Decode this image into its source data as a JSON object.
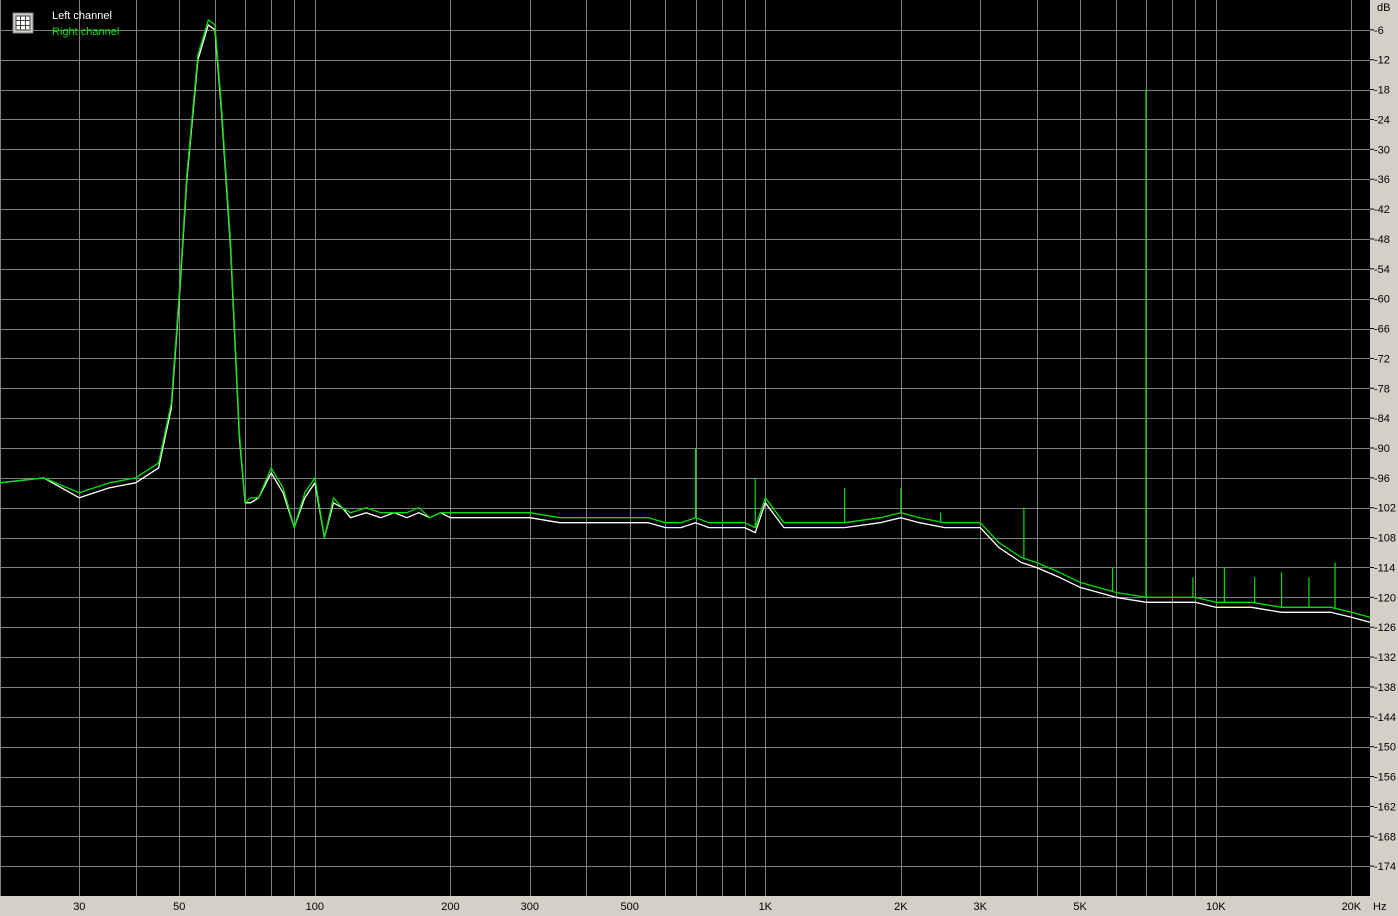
{
  "chart_data": {
    "type": "line",
    "x_scale": "log",
    "xlim": [
      20,
      22000
    ],
    "ylim": [
      -180,
      0
    ],
    "grid": true,
    "legend_position": "top-left",
    "y_unit": "dB",
    "x_unit": "Hz",
    "y_ticks": [
      "-6",
      "-12",
      "-18",
      "-24",
      "-30",
      "-36",
      "-42",
      "-48",
      "-54",
      "-60",
      "-66",
      "-72",
      "-78",
      "-84",
      "-90",
      "-96",
      "-102",
      "-108",
      "-114",
      "-120",
      "-126",
      "-132",
      "-138",
      "-144",
      "-150",
      "-156",
      "-162",
      "-168",
      "-174"
    ],
    "x_ticks": [
      {
        "value": 30,
        "label": "30"
      },
      {
        "value": 50,
        "label": "50"
      },
      {
        "value": 100,
        "label": "100"
      },
      {
        "value": 200,
        "label": "200"
      },
      {
        "value": 300,
        "label": "300"
      },
      {
        "value": 500,
        "label": "500"
      },
      {
        "value": 1000,
        "label": "1K"
      },
      {
        "value": 2000,
        "label": "2K"
      },
      {
        "value": 3000,
        "label": "3K"
      },
      {
        "value": 5000,
        "label": "5K"
      },
      {
        "value": 10000,
        "label": "10K"
      },
      {
        "value": 20000,
        "label": "20K"
      }
    ],
    "series": [
      {
        "name": "Left channel",
        "color": "#ffffff",
        "x": [
          20,
          25,
          30,
          35,
          40,
          45,
          48,
          50,
          52,
          55,
          58,
          60,
          62,
          65,
          68,
          70,
          72,
          75,
          80,
          85,
          90,
          95,
          100,
          105,
          110,
          115,
          120,
          130,
          140,
          150,
          160,
          170,
          180,
          190,
          200,
          220,
          250,
          300,
          350,
          400,
          450,
          500,
          550,
          600,
          650,
          700,
          750,
          800,
          850,
          900,
          950,
          1000,
          1100,
          1200,
          1300,
          1500,
          1800,
          2000,
          2200,
          2500,
          2800,
          3000,
          3300,
          3700,
          4000,
          4500,
          5000,
          6000,
          7000,
          8000,
          9000,
          10000,
          12000,
          14000,
          16000,
          18000,
          20000,
          22000
        ],
        "y": [
          -97,
          -96,
          -100,
          -98,
          -97,
          -94,
          -82,
          -60,
          -36,
          -12,
          -5,
          -6,
          -22,
          -50,
          -88,
          -101,
          -101,
          -100,
          -95,
          -99,
          -106,
          -100,
          -97,
          -108,
          -101,
          -102,
          -104,
          -103,
          -104,
          -103,
          -104,
          -103,
          -104,
          -103,
          -104,
          -104,
          -104,
          -104,
          -105,
          -105,
          -105,
          -105,
          -105,
          -106,
          -106,
          -105,
          -106,
          -106,
          -106,
          -106,
          -107,
          -101,
          -106,
          -106,
          -106,
          -106,
          -105,
          -104,
          -105,
          -106,
          -106,
          -106,
          -110,
          -113,
          -114,
          -116,
          -118,
          -120,
          -121,
          -121,
          -121,
          -122,
          -122,
          -123,
          -123,
          -123,
          -124,
          -125
        ]
      },
      {
        "name": "Right channel",
        "color": "#00e000",
        "x": [
          20,
          25,
          30,
          35,
          40,
          45,
          48,
          50,
          52,
          55,
          58,
          60,
          62,
          65,
          68,
          70,
          72,
          75,
          80,
          85,
          90,
          95,
          100,
          105,
          110,
          115,
          120,
          130,
          140,
          150,
          160,
          170,
          180,
          190,
          200,
          220,
          250,
          300,
          350,
          400,
          450,
          500,
          550,
          600,
          650,
          700,
          750,
          800,
          850,
          900,
          950,
          1000,
          1100,
          1200,
          1300,
          1500,
          1800,
          2000,
          2200,
          2500,
          2800,
          3000,
          3300,
          3700,
          4000,
          4500,
          5000,
          6000,
          7000,
          8000,
          9000,
          10000,
          12000,
          14000,
          16000,
          18000,
          20000,
          22000
        ],
        "y": [
          -97,
          -96,
          -99,
          -97,
          -96,
          -93,
          -81,
          -59,
          -35,
          -11,
          -4,
          -5,
          -21,
          -49,
          -87,
          -101,
          -100,
          -100,
          -94,
          -98,
          -106,
          -99,
          -96,
          -108,
          -100,
          -102,
          -103,
          -102,
          -103,
          -103,
          -103,
          -102,
          -104,
          -103,
          -103,
          -103,
          -103,
          -103,
          -104,
          -104,
          -104,
          -104,
          -104,
          -105,
          -105,
          -104,
          -105,
          -105,
          -105,
          -105,
          -106,
          -100,
          -105,
          -105,
          -105,
          -105,
          -104,
          -103,
          -104,
          -105,
          -105,
          -105,
          -109,
          -112,
          -113,
          -115,
          -117,
          -119,
          -120,
          -120,
          -120,
          -121,
          -121,
          -122,
          -122,
          -122,
          -123,
          -124
        ]
      }
    ],
    "spikes": [
      {
        "x": 700,
        "y": -90
      },
      {
        "x": 950,
        "y": -96
      },
      {
        "x": 1500,
        "y": -98
      },
      {
        "x": 2000,
        "y": -98
      },
      {
        "x": 2450,
        "y": -103
      },
      {
        "x": 3750,
        "y": -102
      },
      {
        "x": 5900,
        "y": -114
      },
      {
        "x": 7000,
        "y": -18
      },
      {
        "x": 8900,
        "y": -116
      },
      {
        "x": 10450,
        "y": -114
      },
      {
        "x": 12200,
        "y": -116
      },
      {
        "x": 14000,
        "y": -115
      },
      {
        "x": 16100,
        "y": -116
      },
      {
        "x": 18400,
        "y": -113
      }
    ]
  }
}
